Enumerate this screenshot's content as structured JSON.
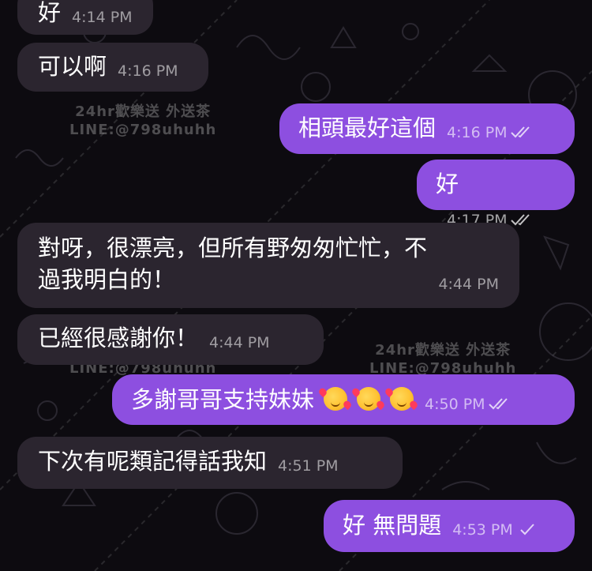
{
  "chat": {
    "messages": [
      {
        "dir": "in",
        "text": "好",
        "time": "4:14 PM"
      },
      {
        "dir": "in",
        "text": "可以啊",
        "time": "4:16 PM"
      },
      {
        "dir": "out",
        "text": "相頭最好這個",
        "time": "4:16 PM",
        "status": "read"
      },
      {
        "dir": "out",
        "text": "好",
        "time": "4:17 PM",
        "status": "read"
      },
      {
        "dir": "in",
        "text": "對呀，很漂亮，但所有野匆匆忙忙，不過我明白的！",
        "line1": "對呀，很漂亮，但所有野匆匆忙忙，不",
        "line2": "過我明白的！",
        "time": "4:44 PM"
      },
      {
        "dir": "in",
        "text": "已經很感謝你！",
        "time": "4:44 PM"
      },
      {
        "dir": "out",
        "text": "多謝哥哥支持妹妹",
        "time": "4:50 PM",
        "status": "read",
        "emoji": [
          "smiling-face-with-hearts",
          "smiling-face-with-hearts",
          "smiling-face-with-hearts"
        ]
      },
      {
        "dir": "in",
        "text": "下次有呢類記得話我知",
        "time": "4:51 PM"
      },
      {
        "dir": "out",
        "text": "好 無問題",
        "time": "4:53 PM",
        "status": "sent"
      }
    ]
  },
  "watermarks": {
    "line1": "24hr歡樂送 外送茶",
    "line2": "LINE:@798uhuhh"
  },
  "colors": {
    "background": "#0d0b10",
    "incoming_bubble": "#2b252f",
    "outgoing_bubble": "#8d4fe0"
  }
}
